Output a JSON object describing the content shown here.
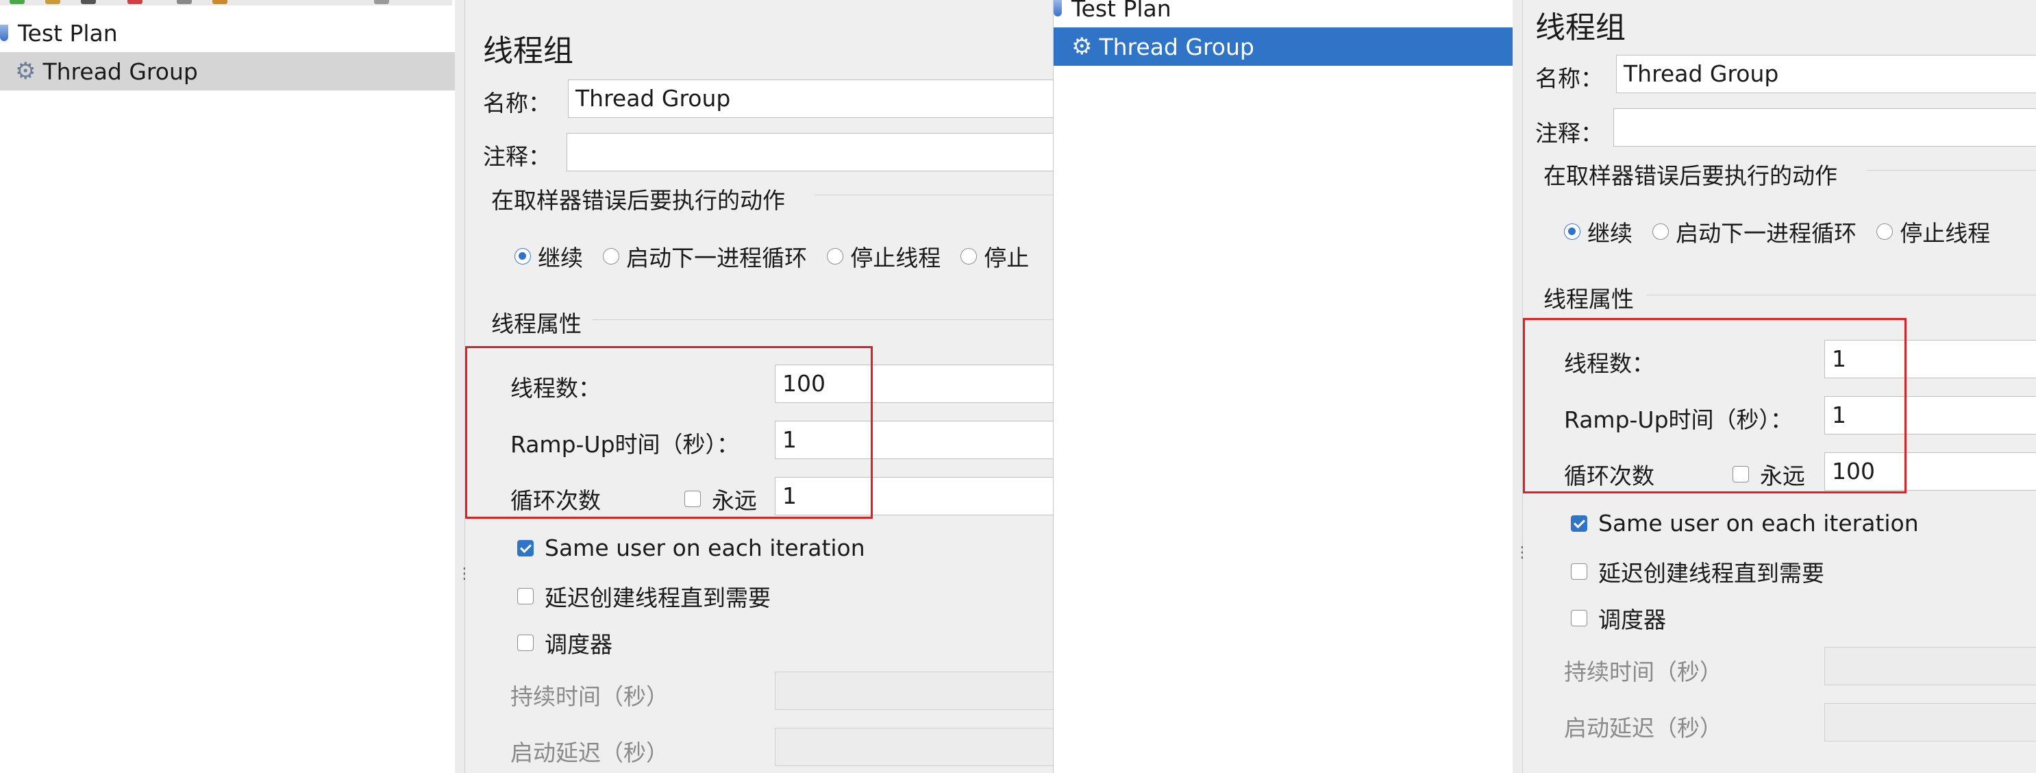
{
  "left": {
    "tree": {
      "test_plan": "Test Plan",
      "thread_group": "Thread Group"
    },
    "form": {
      "title": "线程组",
      "name_label": "名称：",
      "name_value": "Thread Group",
      "comment_label": "注释：",
      "comment_value": "",
      "on_error_title": "在取样器错误后要执行的动作",
      "options": [
        "继续",
        "启动下一进程循环",
        "停止线程",
        "停止"
      ],
      "selected_option": "继续",
      "props_title": "线程属性",
      "threads_label": "线程数：",
      "threads_value": "100",
      "rampup_label": "Ramp-Up时间（秒）：",
      "rampup_value": "1",
      "loops_label": "循环次数",
      "forever_label": "永远",
      "forever_checked": false,
      "loops_value": "1",
      "same_user_label": "Same user on each iteration",
      "same_user_checked": true,
      "delay_create_label": "延迟创建线程直到需要",
      "delay_create_checked": false,
      "scheduler_label": "调度器",
      "scheduler_checked": false,
      "duration_label": "持续时间（秒）",
      "startup_delay_label": "启动延迟（秒）"
    }
  },
  "right": {
    "tree": {
      "test_plan": "Test Plan",
      "thread_group": "Thread Group"
    },
    "form": {
      "title": "线程组",
      "name_label": "名称：",
      "name_value": "Thread Group",
      "comment_label": "注释：",
      "comment_value": "",
      "on_error_title": "在取样器错误后要执行的动作",
      "options": [
        "继续",
        "启动下一进程循环",
        "停止线程"
      ],
      "selected_option": "继续",
      "props_title": "线程属性",
      "threads_label": "线程数：",
      "threads_value": "1",
      "rampup_label": "Ramp-Up时间（秒）：",
      "rampup_value": "1",
      "loops_label": "循环次数",
      "forever_label": "永远",
      "forever_checked": false,
      "loops_value": "100",
      "same_user_label": "Same user on each iteration",
      "same_user_checked": true,
      "delay_create_label": "延迟创建线程直到需要",
      "delay_create_checked": false,
      "scheduler_label": "调度器",
      "scheduler_checked": false,
      "duration_label": "持续时间（秒）",
      "startup_delay_label": "启动延迟（秒）"
    }
  },
  "colors": {
    "highlight": "#e02020",
    "selection_blue": "#2f74c7",
    "selection_grey": "#d5d5d5"
  },
  "icons": [
    "flask-icon",
    "gear-icon",
    "drag-grip-icon"
  ]
}
